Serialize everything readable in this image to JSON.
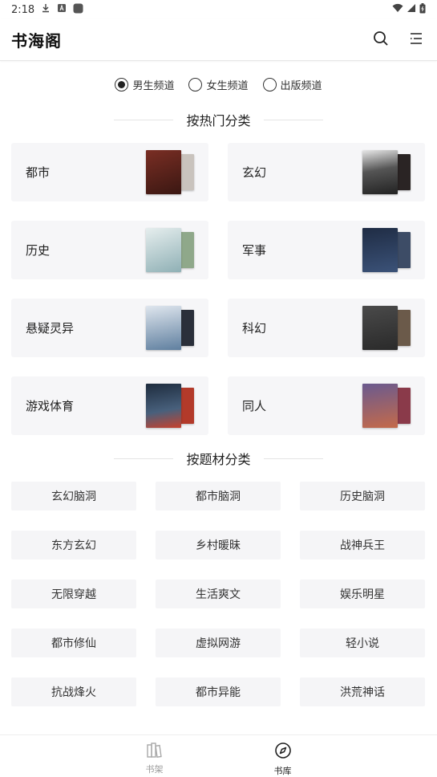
{
  "status_bar": {
    "time": "2:18"
  },
  "app": {
    "title": "书海阁"
  },
  "channels": [
    {
      "label": "男生频道",
      "selected": true
    },
    {
      "label": "女生频道",
      "selected": false
    },
    {
      "label": "出版频道",
      "selected": false
    }
  ],
  "hot_section": {
    "title": "按热门分类"
  },
  "hot_categories": [
    {
      "name": "都市",
      "cover_front": "#5a2a22",
      "cover_back": "#c9c3bd"
    },
    {
      "name": "玄幻",
      "cover_front": "#3b3b3b",
      "cover_back": "#2a2424"
    },
    {
      "name": "历史",
      "cover_front": "#9fb8b8",
      "cover_back": "#7f9a7f"
    },
    {
      "name": "军事",
      "cover_front": "#2c3e5a",
      "cover_back": "#3d4c66"
    },
    {
      "name": "悬疑灵异",
      "cover_front": "#4f6f8f",
      "cover_back": "#2a2f3a"
    },
    {
      "name": "科幻",
      "cover_front": "#3a3a3a",
      "cover_back": "#6b5a4a"
    },
    {
      "name": "游戏体育",
      "cover_front": "#2e3f55",
      "cover_back": "#b33a2a"
    },
    {
      "name": "同人",
      "cover_front": "#5a4a7a",
      "cover_back": "#8a3a4a"
    }
  ],
  "topic_section": {
    "title": "按题材分类"
  },
  "topics": [
    "玄幻脑洞",
    "都市脑洞",
    "历史脑洞",
    "东方玄幻",
    "乡村暖昧",
    "战神兵王",
    "无限穿越",
    "生活爽文",
    "娱乐明星",
    "都市修仙",
    "虚拟网游",
    "轻小说",
    "抗战烽火",
    "都市异能",
    "洪荒神话"
  ],
  "bottom_nav": [
    {
      "label": "书架",
      "active": false
    },
    {
      "label": "书库",
      "active": true
    }
  ]
}
